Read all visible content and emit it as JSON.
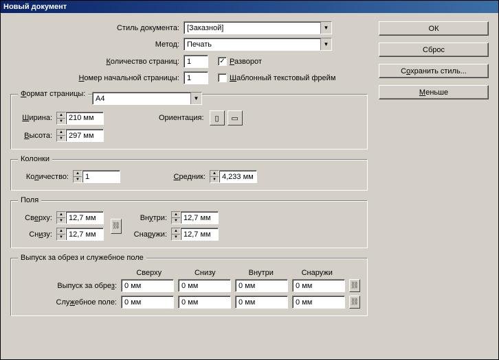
{
  "window": {
    "title": "Новый документ"
  },
  "buttons": {
    "ok": "ОК",
    "reset": "Сброс",
    "save_style": "Сохранить стиль...",
    "less": "Меньше"
  },
  "top": {
    "doc_style_label": "Стиль документа:",
    "doc_style_value": "[Заказной]",
    "method_label": "Метод:",
    "method_value": "Печать",
    "pages_label": "Количество страниц:",
    "pages_value": "1",
    "start_page_label": "Номер начальной страницы:",
    "start_page_value": "1",
    "spread_label": "Разворот",
    "spread_checked": true,
    "master_frame_label": "Шаблонный текстовый фрейм",
    "master_frame_checked": false
  },
  "page_format": {
    "legend": "Формат страницы:",
    "format_value": "A4",
    "width_label": "Ширина:",
    "width_value": "210 мм",
    "height_label": "Высота:",
    "height_value": "297 мм",
    "orientation_label": "Ориентация:"
  },
  "columns": {
    "legend": "Колонки",
    "count_label": "Количество:",
    "count_value": "1",
    "gutter_label": "Средник:",
    "gutter_value": "4,233 мм"
  },
  "margins": {
    "legend": "Поля",
    "top_label": "Сверху:",
    "top_value": "12,7 мм",
    "bottom_label": "Снизу:",
    "bottom_value": "12,7 мм",
    "inside_label": "Внутри:",
    "inside_value": "12,7 мм",
    "outside_label": "Снаружи:",
    "outside_value": "12,7 мм"
  },
  "bleed_slug": {
    "legend": "Выпуск за обрез и служебное поле",
    "hdr_top": "Сверху",
    "hdr_bottom": "Снизу",
    "hdr_inside": "Внутри",
    "hdr_outside": "Снаружи",
    "bleed_label": "Выпуск за обрез:",
    "slug_label": "Служебное поле:",
    "zero": "0 мм"
  }
}
